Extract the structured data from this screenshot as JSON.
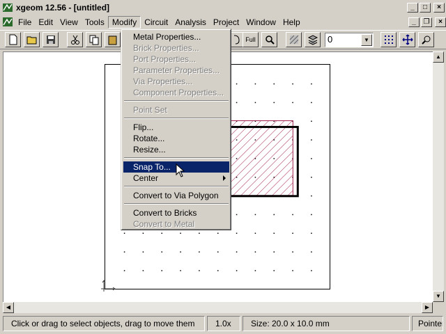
{
  "window": {
    "title": "xgeom 12.56 - [untitled]"
  },
  "menubar": {
    "items": [
      "File",
      "Edit",
      "View",
      "Tools",
      "Modify",
      "Circuit",
      "Analysis",
      "Project",
      "Window",
      "Help"
    ],
    "active": "Modify"
  },
  "toolbar": {
    "full_label": "Full",
    "layer_value": "0"
  },
  "modify_menu": {
    "items": [
      {
        "label": "Metal Properties...",
        "enabled": true
      },
      {
        "label": "Brick Properties...",
        "enabled": false
      },
      {
        "label": "Port Properties...",
        "enabled": false
      },
      {
        "label": "Parameter Properties...",
        "enabled": false
      },
      {
        "label": "Via Properties...",
        "enabled": false
      },
      {
        "label": "Component Properties...",
        "enabled": false
      },
      {
        "label": "Point Set",
        "enabled": false
      },
      {
        "label": "Flip...",
        "enabled": true
      },
      {
        "label": "Rotate...",
        "enabled": true
      },
      {
        "label": "Resize...",
        "enabled": true
      },
      {
        "label": "Snap To...",
        "enabled": true,
        "highlighted": true
      },
      {
        "label": "Center",
        "enabled": true,
        "submenu": true
      },
      {
        "label": "Convert to Via Polygon",
        "enabled": true
      },
      {
        "label": "Convert to Bricks",
        "enabled": true
      },
      {
        "label": "Convert to Metal",
        "enabled": false
      }
    ]
  },
  "statusbar": {
    "message": "Click or drag to select objects, drag to move them",
    "zoom": "1.0x",
    "size": "Size: 20.0 x 10.0 mm",
    "mode": "Pointer"
  },
  "colors": {
    "menu_highlight": "#0a246a",
    "hatch": "#a0204a",
    "face": "#d4d0c8"
  }
}
